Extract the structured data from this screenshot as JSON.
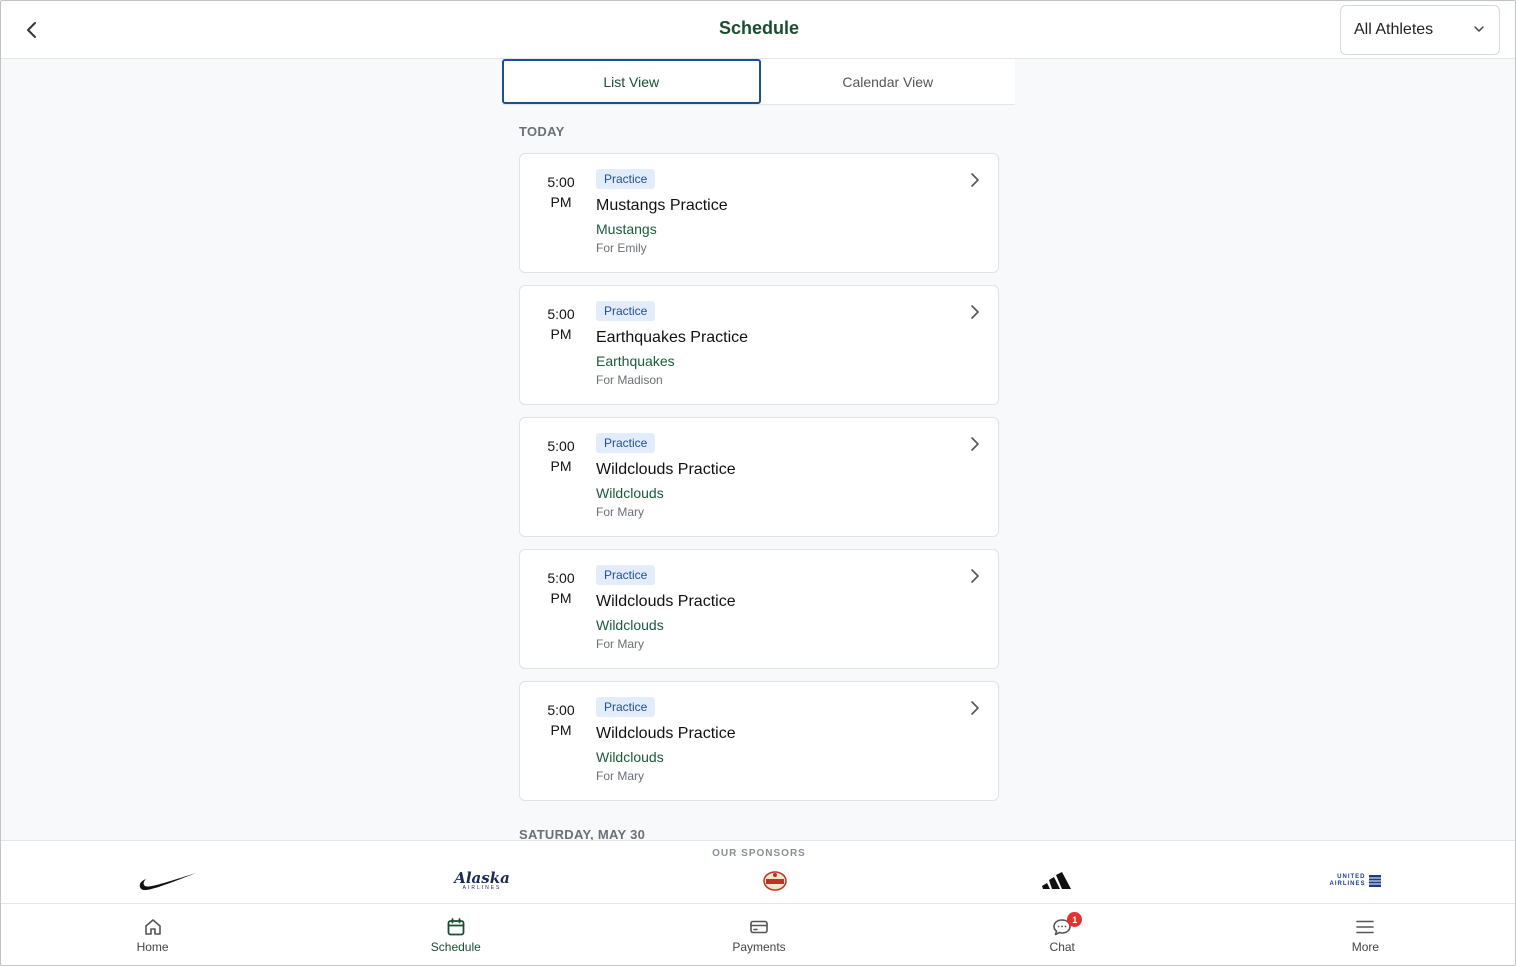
{
  "header": {
    "title": "Schedule",
    "athlete_filter": "All Athletes"
  },
  "tabs": [
    {
      "label": "List View",
      "active": true
    },
    {
      "label": "Calendar View",
      "active": false
    }
  ],
  "sections": {
    "today": "TODAY",
    "next": "SATURDAY, MAY 30"
  },
  "events": [
    {
      "time": "5:00",
      "ampm": "PM",
      "type": "Practice",
      "title": "Mustangs Practice",
      "team": "Mustangs",
      "for": "For Emily"
    },
    {
      "time": "5:00",
      "ampm": "PM",
      "type": "Practice",
      "title": "Earthquakes Practice",
      "team": "Earthquakes",
      "for": "For Madison"
    },
    {
      "time": "5:00",
      "ampm": "PM",
      "type": "Practice",
      "title": "Wildclouds Practice",
      "team": "Wildclouds",
      "for": "For Mary"
    },
    {
      "time": "5:00",
      "ampm": "PM",
      "type": "Practice",
      "title": "Wildclouds Practice",
      "team": "Wildclouds",
      "for": "For Mary"
    },
    {
      "time": "5:00",
      "ampm": "PM",
      "type": "Practice",
      "title": "Wildclouds Practice",
      "team": "Wildclouds",
      "for": "For Mary"
    }
  ],
  "sponsors": {
    "label": "OUR SPONSORS",
    "items": [
      {
        "name": "nike-logo"
      },
      {
        "name": "alaska-airlines-logo",
        "text": "Alaska",
        "subtext": "AIRLINES"
      },
      {
        "name": "sponsor-seal-logo"
      },
      {
        "name": "adidas-logo"
      },
      {
        "name": "united-airlines-logo",
        "text": "UNITED",
        "subtext": "AIRLINES"
      }
    ]
  },
  "nav": [
    {
      "label": "Home",
      "icon": "home-icon"
    },
    {
      "label": "Schedule",
      "icon": "calendar-icon",
      "active": true
    },
    {
      "label": "Payments",
      "icon": "card-icon"
    },
    {
      "label": "Chat",
      "icon": "chat-icon",
      "badge": "1"
    },
    {
      "label": "More",
      "icon": "menu-icon"
    }
  ],
  "colors": {
    "brand_green": "#1b4d33",
    "accent_blue": "#1e4f8f",
    "badge_bg": "#e3ecfb",
    "notification_red": "#e5312f"
  }
}
